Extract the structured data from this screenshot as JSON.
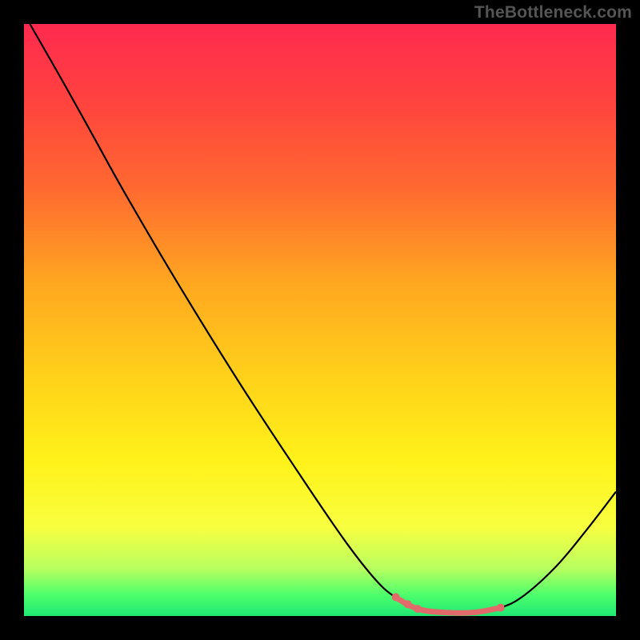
{
  "watermark": {
    "text": "TheBottleneck.com"
  },
  "chart_data": {
    "type": "line",
    "title": "",
    "xlabel": "",
    "ylabel": "",
    "xlim": [
      0,
      1
    ],
    "ylim": [
      0,
      1
    ],
    "series": [
      {
        "name": "bottleneck-curve",
        "color": "#000000",
        "points": [
          {
            "x": 0.01,
            "y": 1.0
          },
          {
            "x": 0.07,
            "y": 0.895
          },
          {
            "x": 0.12,
            "y": 0.805
          },
          {
            "x": 0.17,
            "y": 0.715
          },
          {
            "x": 0.255,
            "y": 0.57
          },
          {
            "x": 0.36,
            "y": 0.4
          },
          {
            "x": 0.455,
            "y": 0.255
          },
          {
            "x": 0.54,
            "y": 0.13
          },
          {
            "x": 0.595,
            "y": 0.06
          },
          {
            "x": 0.63,
            "y": 0.03
          },
          {
            "x": 0.665,
            "y": 0.012
          },
          {
            "x": 0.71,
            "y": 0.006
          },
          {
            "x": 0.76,
            "y": 0.006
          },
          {
            "x": 0.805,
            "y": 0.014
          },
          {
            "x": 0.845,
            "y": 0.035
          },
          {
            "x": 0.9,
            "y": 0.085
          },
          {
            "x": 0.95,
            "y": 0.145
          },
          {
            "x": 1.0,
            "y": 0.21
          }
        ]
      },
      {
        "name": "segment-overlay",
        "color": "#e26a6a",
        "points": [
          {
            "x": 0.63,
            "y": 0.03
          },
          {
            "x": 0.665,
            "y": 0.012
          },
          {
            "x": 0.71,
            "y": 0.006
          },
          {
            "x": 0.76,
            "y": 0.006
          },
          {
            "x": 0.805,
            "y": 0.014
          }
        ]
      }
    ],
    "markers": [
      {
        "x": 0.628,
        "y": 0.032,
        "r": 5,
        "color": "#e26a6a"
      },
      {
        "x": 0.648,
        "y": 0.02,
        "r": 5,
        "color": "#e26a6a"
      },
      {
        "x": 0.665,
        "y": 0.012,
        "r": 5,
        "color": "#e26a6a"
      },
      {
        "x": 0.805,
        "y": 0.014,
        "r": 5,
        "color": "#e26a6a"
      }
    ],
    "gradient_stops": [
      {
        "pos": 0.0,
        "color": "#ff2a4f"
      },
      {
        "pos": 0.12,
        "color": "#ff4040"
      },
      {
        "pos": 0.28,
        "color": "#ff6a30"
      },
      {
        "pos": 0.44,
        "color": "#ffa820"
      },
      {
        "pos": 0.6,
        "color": "#ffd21a"
      },
      {
        "pos": 0.74,
        "color": "#fff21a"
      },
      {
        "pos": 0.85,
        "color": "#f8ff40"
      },
      {
        "pos": 0.92,
        "color": "#b8ff60"
      },
      {
        "pos": 0.965,
        "color": "#4cff6c"
      },
      {
        "pos": 1.0,
        "color": "#20e874"
      }
    ]
  }
}
